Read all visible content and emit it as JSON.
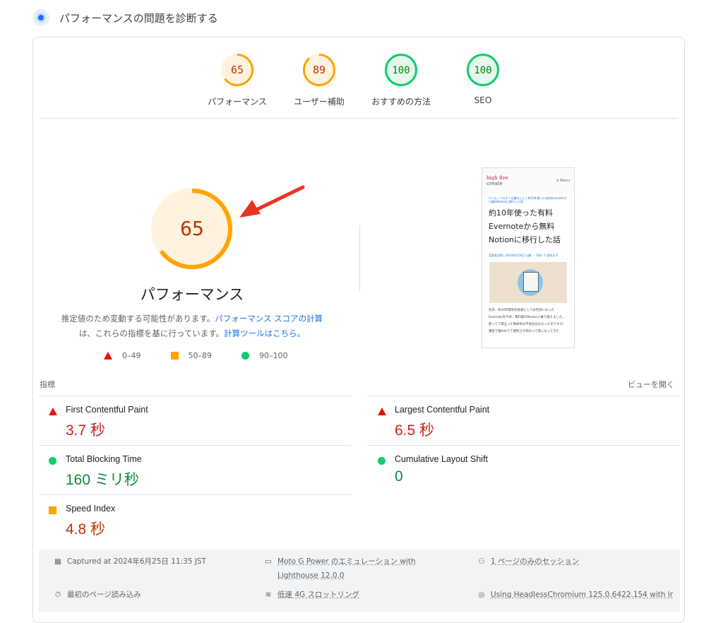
{
  "header": {
    "title": "パフォーマンスの問題を診断する"
  },
  "gauges": [
    {
      "score": "65",
      "label": "パフォーマンス",
      "color": "#ffa400",
      "fill": 0.65,
      "bg": "#fff3e0",
      "text": "#c33300"
    },
    {
      "score": "89",
      "label": "ユーザー補助",
      "color": "#ffa400",
      "fill": 0.89,
      "bg": "#fff3e0",
      "text": "#c33300"
    },
    {
      "score": "100",
      "label": "おすすめの方法",
      "color": "#0cce6b",
      "fill": 1.0,
      "bg": "#e6f8ee",
      "text": "#008800"
    },
    {
      "score": "100",
      "label": "SEO",
      "color": "#0cce6b",
      "fill": 1.0,
      "bg": "#e6f8ee",
      "text": "#008800"
    }
  ],
  "main_score": {
    "score": "65",
    "label": "パフォーマンス",
    "fill": 0.65
  },
  "description": {
    "line1_prefix": "推定値のため変動する可能性があります。",
    "line1_link": "パフォーマンス スコアの計算",
    "line2_prefix": "は、これらの指標を基に行っています。",
    "line2_link": "計算ツールはこちら。"
  },
  "legend": {
    "poor": "0–49",
    "average": "50–89",
    "good": "90–100"
  },
  "page_screenshot": {
    "logo_top": "high five",
    "logo_bottom": "create",
    "menu": "≡ Menu",
    "breadcrumb": "ホーム / ブログ / 仕事のこと / 約10年使った有料Evernoteから無料Notionに移行した話",
    "title": "約10年使った有料Evernoteから無料Notionに移行した話",
    "meta": "宮部宏太郎 | 2024年2月6日 公開 ・ 16分 で 読めます",
    "body": "先日、約10年間有料会員としてお世話になったEvernoteをやめ、無料版のNotionに乗り換えました。使ってて目立った致命的な不具合はなかったのですが、課金で増われてて便利さが伝わって来になってきた"
  },
  "metrics_section": {
    "label": "指標",
    "expand": "ビューを開く"
  },
  "metrics": [
    {
      "name": "First Contentful Paint",
      "value": "3.7 秒",
      "status": "poor"
    },
    {
      "name": "Largest Contentful Paint",
      "value": "6.5 秒",
      "status": "poor"
    },
    {
      "name": "Total Blocking Time",
      "value": "160 ミリ秒",
      "status": "good"
    },
    {
      "name": "Cumulative Layout Shift",
      "value": "0",
      "status": "good"
    },
    {
      "name": "Speed Index",
      "value": "4.8 秒",
      "status": "average"
    }
  ],
  "footer": {
    "captured": "Captured at 2024年6月25日 11:35 JST",
    "device": "Moto G Power のエミュレーション with",
    "lighthouse": "Lighthouse 12.0.0",
    "session": "1 ページのみのセッション",
    "load": "最初のページ読み込み",
    "throttle": "低速 4G スロットリング",
    "browser": "Using HeadlessChromium 125.0.6422.154 with lr"
  }
}
